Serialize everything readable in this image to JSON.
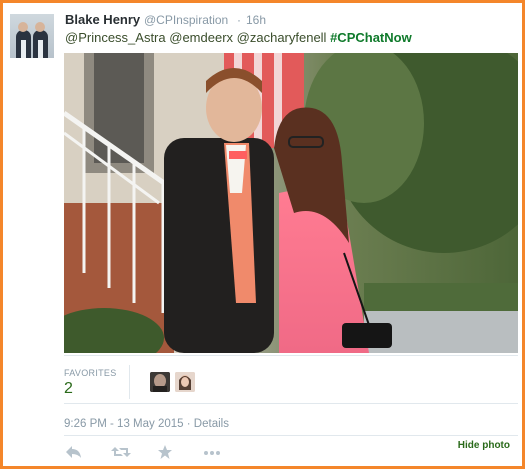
{
  "tweet": {
    "author_name": "Blake Henry",
    "author_handle": "@CPInspiration",
    "separator": "·",
    "timestamp": "16h",
    "text": {
      "mentions": [
        "@Princess_Astra",
        "@emdeerx",
        "@zacharyfenell"
      ],
      "hashtag": "#CPChatNow"
    },
    "favorites_label": "FAVORITES",
    "favorites_count": "2",
    "date_time": "9:26 PM - 13 May 2015",
    "meta_separator": "·",
    "details_link": "Details",
    "hide_photo_link": "Hide photo"
  },
  "actions": [
    {
      "name": "reply-icon"
    },
    {
      "name": "retweet-icon"
    },
    {
      "name": "favorite-star-icon"
    },
    {
      "name": "more-dots-icon"
    }
  ],
  "colors": {
    "frame_border": "#f4862a",
    "hashtag": "#0f7a2b",
    "meta_gray": "#8899a6"
  }
}
